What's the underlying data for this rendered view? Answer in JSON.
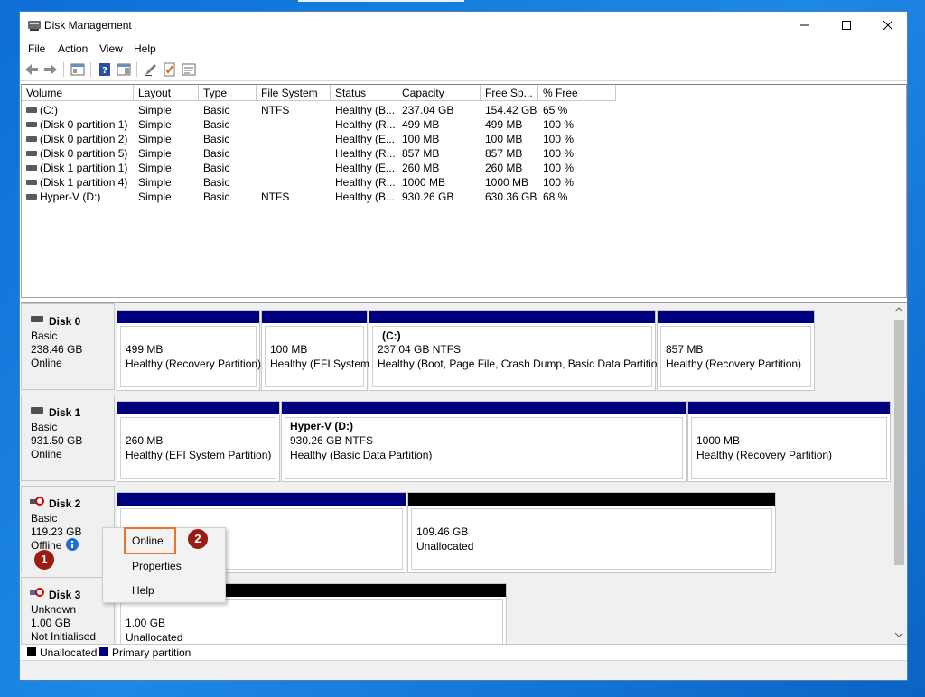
{
  "window": {
    "title": "Disk Management",
    "menu": [
      "File",
      "Action",
      "View",
      "Help"
    ]
  },
  "volumes": {
    "columns": [
      "Volume",
      "Layout",
      "Type",
      "File System",
      "Status",
      "Capacity",
      "Free Sp...",
      "% Free"
    ],
    "rows": [
      [
        "(C:)",
        "Simple",
        "Basic",
        "NTFS",
        "Healthy (B...",
        "237.04 GB",
        "154.42 GB",
        "65 %"
      ],
      [
        "(Disk 0 partition 1)",
        "Simple",
        "Basic",
        "",
        "Healthy (R...",
        "499 MB",
        "499 MB",
        "100 %"
      ],
      [
        "(Disk 0 partition 2)",
        "Simple",
        "Basic",
        "",
        "Healthy (E...",
        "100 MB",
        "100 MB",
        "100 %"
      ],
      [
        "(Disk 0 partition 5)",
        "Simple",
        "Basic",
        "",
        "Healthy (R...",
        "857 MB",
        "857 MB",
        "100 %"
      ],
      [
        "(Disk 1 partition 1)",
        "Simple",
        "Basic",
        "",
        "Healthy (E...",
        "260 MB",
        "260 MB",
        "100 %"
      ],
      [
        "(Disk 1 partition 4)",
        "Simple",
        "Basic",
        "",
        "Healthy (R...",
        "1000 MB",
        "1000 MB",
        "100 %"
      ],
      [
        "Hyper-V (D:)",
        "Simple",
        "Basic",
        "NTFS",
        "Healthy (B...",
        "930.26 GB",
        "630.36 GB",
        "68 %"
      ]
    ]
  },
  "disks": [
    {
      "name": "Disk 0",
      "type": "Basic",
      "size": "238.46 GB",
      "status": "Online",
      "partitions": [
        {
          "title": "",
          "size": "499 MB",
          "status": "Healthy (Recovery Partition)"
        },
        {
          "title": "",
          "size": "100 MB",
          "status": "Healthy (EFI System"
        },
        {
          "title": "(C:)",
          "size": "237.04 GB NTFS",
          "status": "Healthy (Boot, Page File, Crash Dump, Basic Data Partition)"
        },
        {
          "title": "",
          "size": "857 MB",
          "status": "Healthy (Recovery Partition)"
        }
      ]
    },
    {
      "name": "Disk 1",
      "type": "Basic",
      "size": "931.50 GB",
      "status": "Online",
      "partitions": [
        {
          "title": "",
          "size": "260 MB",
          "status": "Healthy (EFI System Partition)"
        },
        {
          "title": "Hyper-V  (D:)",
          "size": "930.26 GB NTFS",
          "status": "Healthy (Basic Data Partition)"
        },
        {
          "title": "",
          "size": "1000 MB",
          "status": "Healthy (Recovery Partition)"
        }
      ]
    },
    {
      "name": "Disk 2",
      "type": "Basic",
      "size": "119.23 GB",
      "status": "Offline",
      "partitions": [
        {
          "title": "",
          "size": "",
          "status": ""
        },
        {
          "title": "",
          "size": "109.46 GB",
          "status": "Unallocated"
        }
      ]
    },
    {
      "name": "Disk 3",
      "type": "Unknown",
      "size": "1.00 GB",
      "status": "Not Initialised",
      "partitions": [
        {
          "title": "",
          "size": "1.00 GB",
          "status": "Unallocated"
        }
      ]
    }
  ],
  "legend": {
    "unallocated": "Unallocated",
    "primary": "Primary partition"
  },
  "context_menu": {
    "online": "Online",
    "properties": "Properties",
    "help": "Help"
  },
  "annotations": {
    "step1": "1",
    "step2": "2"
  },
  "colors": {
    "primary_partition": "#00007f",
    "unallocated": "#000000",
    "highlight": "#e8742e",
    "badge": "#9b1c12"
  }
}
